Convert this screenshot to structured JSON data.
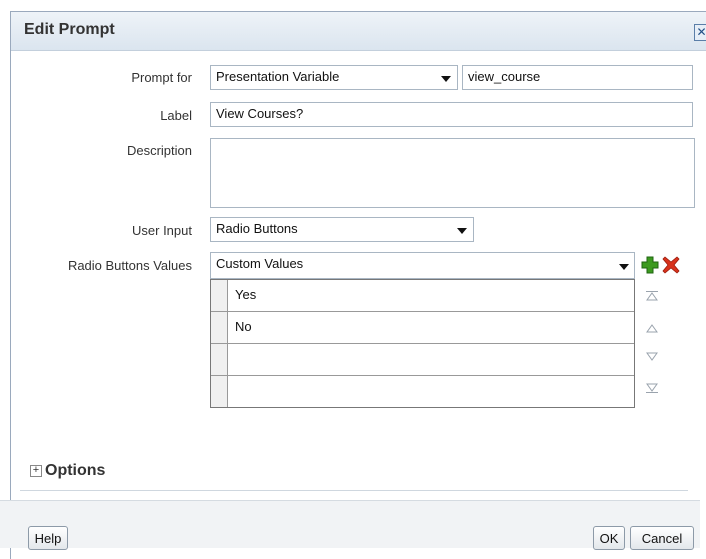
{
  "dialog": {
    "title": "Edit Prompt",
    "close_glyph": "✕"
  },
  "form": {
    "prompt_for_label": "Prompt for",
    "prompt_for_value": "Presentation Variable",
    "variable_name": "view_course",
    "label_label": "Label",
    "label_value": "View Courses?",
    "description_label": "Description",
    "description_value": "",
    "user_input_label": "User Input",
    "user_input_value": "Radio Buttons",
    "values_label": "Radio Buttons Values",
    "values_mode": "Custom Values"
  },
  "values_grid": {
    "rows": [
      "Yes",
      "No",
      "",
      ""
    ]
  },
  "icons": {
    "add": "add-icon",
    "delete": "delete-icon",
    "move_top": "move-to-top-icon",
    "move_up": "move-up-icon",
    "move_down": "move-down-icon",
    "move_bottom": "move-to-bottom-icon",
    "expand": "expand-plus-icon"
  },
  "options": {
    "label": "Options",
    "expand_glyph": "⊞"
  },
  "footer": {
    "help": "Help",
    "ok": "OK",
    "cancel": "Cancel"
  },
  "colors": {
    "add_icon": "#3c9a1f",
    "delete_icon": "#d8321c",
    "title_bar": "#dbe5ef"
  }
}
